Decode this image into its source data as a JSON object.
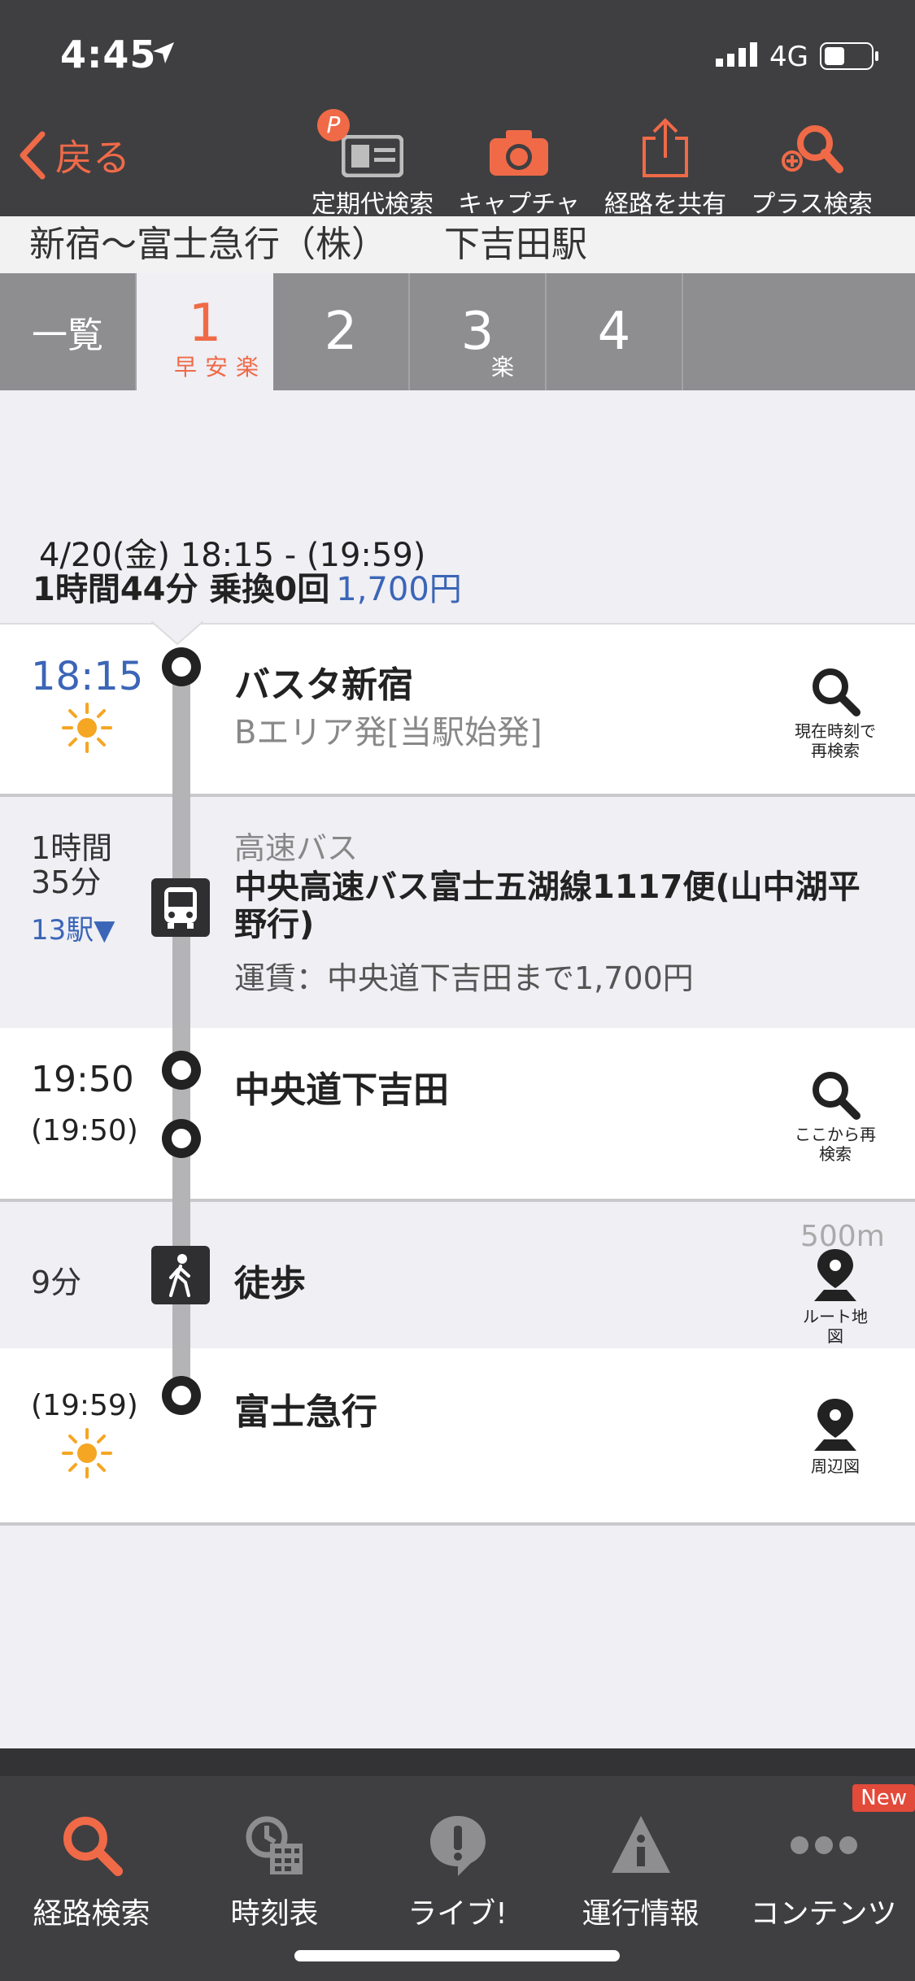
{
  "status": {
    "time": "4:45",
    "network": "4G"
  },
  "header": {
    "back_label": "戻る",
    "tools": [
      {
        "label": "定期代検索",
        "icon": "commuter-pass-icon",
        "badge": "P"
      },
      {
        "label": "キャプチャ",
        "icon": "camera-icon"
      },
      {
        "label": "経路を共有",
        "icon": "share-icon"
      },
      {
        "label": "プラス検索",
        "icon": "plus-search-icon"
      }
    ],
    "route_from": "新宿～富士急行（株）",
    "route_to": "下吉田駅"
  },
  "tabs": [
    {
      "label": "一覧",
      "sub": ""
    },
    {
      "label": "1",
      "sub": "早安楽"
    },
    {
      "label": "2",
      "sub": ""
    },
    {
      "label": "3",
      "sub": "楽"
    },
    {
      "label": "4",
      "sub": ""
    }
  ],
  "summary": {
    "date_time": "4/20(金) 18:15 - (19:59)",
    "duration_transfers": "1時間44分 乗換0回",
    "fare": "1,700円"
  },
  "itinerary": {
    "start": {
      "time": "18:15",
      "station": "バスタ新宿",
      "note": "Bエリア発[当駅始発]",
      "action": "現在時刻で再検索"
    },
    "bus": {
      "duration_line1": "1時間",
      "duration_line2": "35分",
      "stops": "13駅▼",
      "type": "高速バス",
      "name": "中央高速バス富士五湖線1117便(山中湖平野行)",
      "fare": "運賃：中央道下吉田まで1,700円"
    },
    "transfer": {
      "time": "19:50",
      "time2": "(19:50)",
      "station": "中央道下吉田",
      "action": "ここから再検索"
    },
    "walk": {
      "duration": "9分",
      "mode": "徒歩",
      "distance": "500m",
      "action": "ルート地図"
    },
    "end": {
      "time": "(19:59)",
      "station": "富士急行",
      "action": "周辺図"
    }
  },
  "nav": [
    {
      "label": "経路検索",
      "icon": "route-search-icon"
    },
    {
      "label": "時刻表",
      "icon": "timetable-icon"
    },
    {
      "label": "ライブ!",
      "icon": "live-icon"
    },
    {
      "label": "運行情報",
      "icon": "service-info-icon"
    },
    {
      "label": "コンテンツ",
      "icon": "more-icon",
      "badge": "New"
    }
  ],
  "colors": {
    "accent": "#f06a48",
    "blue": "#3b65b7",
    "dark": "#3f3f41",
    "sun": "#f5a623"
  }
}
